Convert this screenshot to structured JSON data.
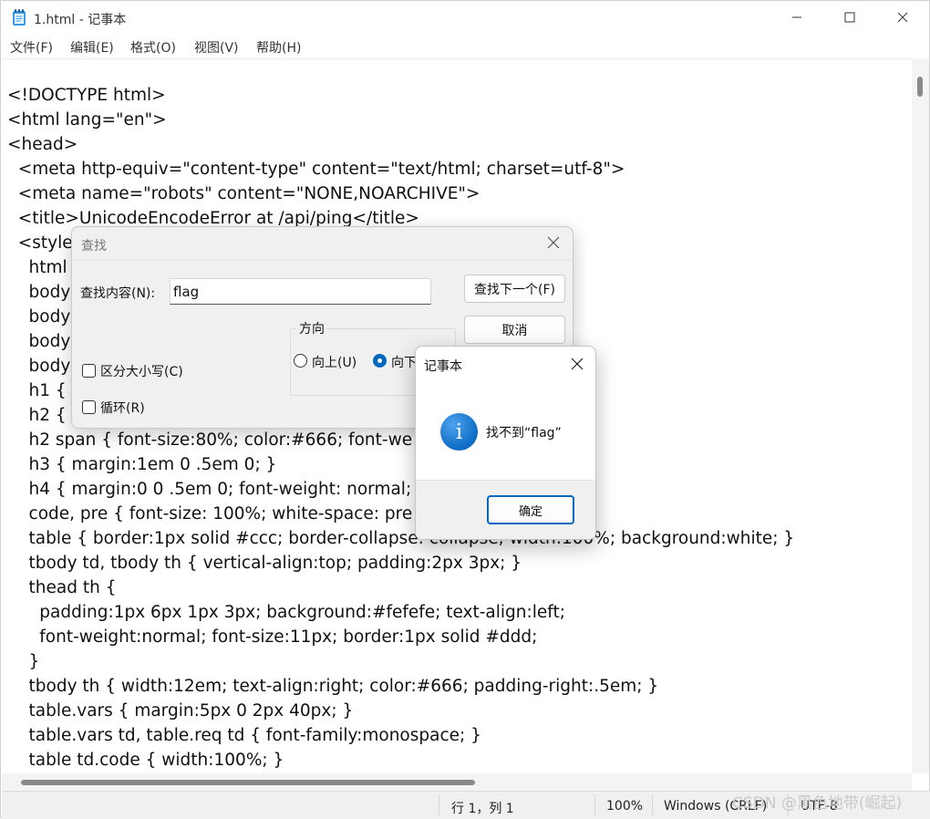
{
  "window": {
    "title": "1.html - 记事本"
  },
  "menu": [
    "文件(F)",
    "编辑(E)",
    "格式(O)",
    "视图(V)",
    "帮助(H)"
  ],
  "editor_lines": [
    "<!DOCTYPE html>",
    "<html lang=\"en\">",
    "<head>",
    "  <meta http-equiv=\"content-type\" content=\"text/html; charset=utf-8\">",
    "  <meta name=\"robots\" content=\"NONE,NOARCHIVE\">",
    "  <title>UnicodeEncodeError at /api/ping</title>",
    "  <style",
    "    html",
    "    body",
    "    body",
    "    body",
    "    body",
    "    h1 { f",
    "    h2 { r",
    "    h2 span { font-size:80%; color:#666; font-we",
    "    h3 { margin:1em 0 .5em 0; }",
    "    h4 { margin:0 0 .5em 0; font-weight: normal;",
    "    code, pre { font-size: 100%; white-space: pre",
    "    table { border:1px solid #ccc; border-collapse: collapse; width:100%; background:white; }",
    "    tbody td, tbody th { vertical-align:top; padding:2px 3px; }",
    "    thead th {",
    "      padding:1px 6px 1px 3px; background:#fefefe; text-align:left;",
    "      font-weight:normal; font-size:11px; border:1px solid #ddd;",
    "    }",
    "    tbody th { width:12em; text-align:right; color:#666; padding-right:.5em; }",
    "    table.vars { margin:5px 0 2px 40px; }",
    "    table.vars td, table.req td { font-family:monospace; }",
    "    table td.code { width:100%; }"
  ],
  "statusbar": {
    "position": "行 1，列 1",
    "zoom": "100%",
    "line_ending": "Windows (CRLF)",
    "encoding": "UTF-8"
  },
  "watermark": "CSDN @黑色地带(崛起)",
  "find_dialog": {
    "title": "查找",
    "find_label": "查找内容(N):",
    "find_value": "flag",
    "find_next": "查找下一个(F)",
    "cancel": "取消",
    "direction_label": "方向",
    "up_label": "向上(U)",
    "down_label": "向下",
    "match_case": "区分大小写(C)",
    "wrap": "循环(R)"
  },
  "message_box": {
    "title": "记事本",
    "text": "找不到“flag”",
    "ok": "确定"
  }
}
